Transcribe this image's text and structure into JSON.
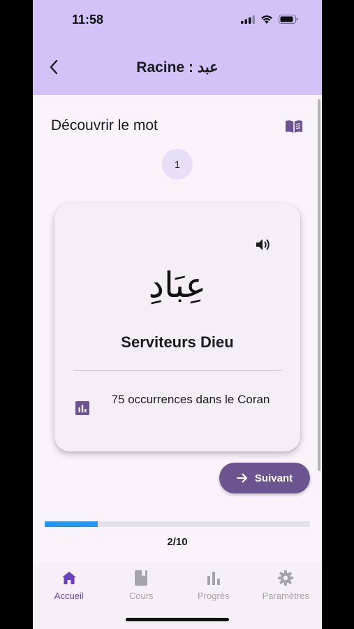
{
  "status_bar": {
    "time": "11:58"
  },
  "app_bar": {
    "title": "Racine : عبد",
    "back_icon": "chevron-left-icon"
  },
  "content": {
    "section_title": "Découvrir le mot",
    "book_icon": "book-open-icon",
    "step_number": "1",
    "card": {
      "arabic_word": "عِبَادِ",
      "translation": "Serviteurs Dieu",
      "speaker_icon": "volume-icon",
      "stats_icon": "bar-chart-icon",
      "occurrences_text": "75 occurrences dans le Coran"
    },
    "next_button": {
      "label": "Suivant",
      "icon": "arrow-right-icon"
    },
    "progress": {
      "value": 0.2,
      "label": "2/10"
    }
  },
  "bottom_nav": {
    "items": [
      {
        "label": "Accueil",
        "icon": "home-icon",
        "active": true
      },
      {
        "label": "Cours",
        "icon": "book-icon",
        "active": false
      },
      {
        "label": "Progrès",
        "icon": "bar-chart-icon",
        "active": false
      },
      {
        "label": "Paramètres",
        "icon": "gear-icon",
        "active": false
      }
    ]
  },
  "colors": {
    "header": "#d2c2f7",
    "background": "#fbf3fb",
    "primary": "#6b548f",
    "accent": "#6a3fc4",
    "progress": "#2196f3",
    "inactive": "#a7a3ab"
  }
}
